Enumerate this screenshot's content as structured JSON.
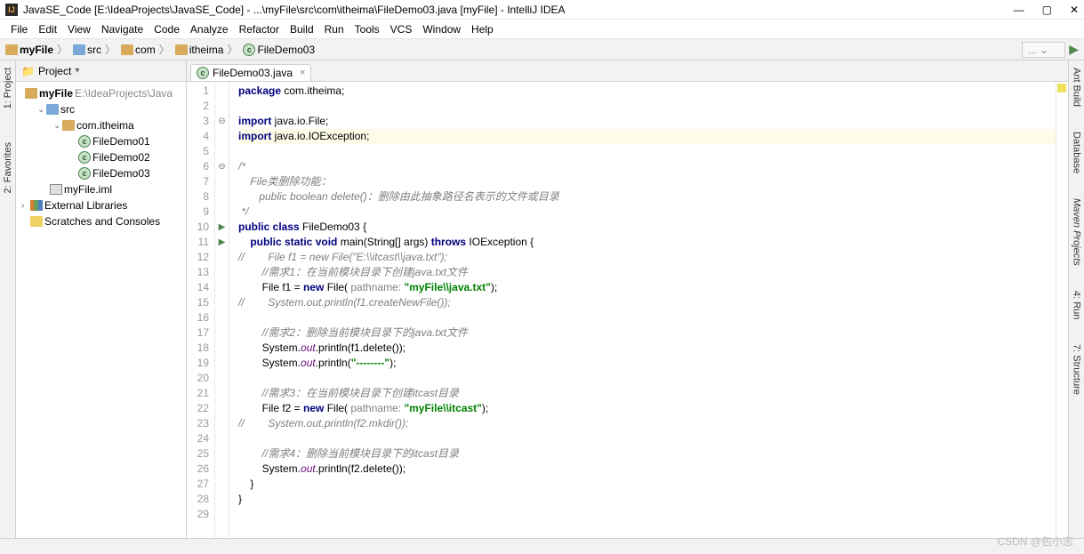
{
  "title": "JavaSE_Code [E:\\IdeaProjects\\JavaSE_Code] - ...\\myFile\\src\\com\\itheima\\FileDemo03.java [myFile] - IntelliJ IDEA",
  "menu": [
    "File",
    "Edit",
    "View",
    "Navigate",
    "Code",
    "Analyze",
    "Refactor",
    "Build",
    "Run",
    "Tools",
    "VCS",
    "Window",
    "Help"
  ],
  "breadcrumb": [
    {
      "icon": "folder",
      "label": "myFile"
    },
    {
      "icon": "folder-blue",
      "label": "src"
    },
    {
      "icon": "folder",
      "label": "com"
    },
    {
      "icon": "folder",
      "label": "itheima"
    },
    {
      "icon": "class",
      "label": "FileDemo03"
    }
  ],
  "run_config": "...",
  "sidebar": {
    "title": "Project",
    "root": {
      "label": "myFile",
      "path": "E:\\IdeaProjects\\Java"
    },
    "src": "src",
    "pkg": "com.itheima",
    "files": [
      "FileDemo01",
      "FileDemo02",
      "FileDemo03"
    ],
    "iml": "myFile.iml",
    "ext": "External Libraries",
    "scratch": "Scratches and Consoles"
  },
  "left_tabs": [
    "2: Favorites",
    "1: Project"
  ],
  "right_tabs": [
    "Ant Build",
    "Database",
    "Maven Projects",
    "4: Run",
    "7: Structure"
  ],
  "tab": "FileDemo03.java",
  "code_lines": [
    {
      "n": 1,
      "t": "<kw>package</kw> com.itheima;"
    },
    {
      "n": 2,
      "t": ""
    },
    {
      "n": 3,
      "g": "⊖",
      "t": "<kw>import</kw> java.io.File;"
    },
    {
      "n": 4,
      "hl": true,
      "t": "<kw>import</kw> java.io.IOException;"
    },
    {
      "n": 5,
      "t": ""
    },
    {
      "n": 6,
      "g": "⊖",
      "t": "<cm>/*</cm>"
    },
    {
      "n": 7,
      "t": "<cm>    File类删除功能：</cm>"
    },
    {
      "n": 8,
      "t": "<cm>       public boolean delete()：删除由此抽象路径名表示的文件或目录</cm>"
    },
    {
      "n": 9,
      "t": "<cm> */</cm>"
    },
    {
      "n": 10,
      "g": "▶",
      "t": "<kw>public class</kw> FileDemo03 {"
    },
    {
      "n": 11,
      "g": "▶",
      "t": "    <kw>public static void</kw> main(String[] args) <kw>throws</kw> <cls>IOException</cls> {"
    },
    {
      "n": 12,
      "t": "<cm>//        File f1 = new File(\"E:\\\\itcast\\\\java.txt\");</cm>"
    },
    {
      "n": 13,
      "t": "        <cm>//需求1：在当前模块目录下创建java.txt文件</cm>"
    },
    {
      "n": 14,
      "t": "        File f1 = <kw>new</kw> File( <param>pathname:</param> <str>\"myFile\\\\java.txt\"</str>);"
    },
    {
      "n": 15,
      "t": "<cm>//        System.out.println(f1.createNewFile());</cm>"
    },
    {
      "n": 16,
      "t": ""
    },
    {
      "n": 17,
      "t": "        <cm>//需求2：删除当前模块目录下的java.txt文件</cm>"
    },
    {
      "n": 18,
      "t": "        System.<stat>out</stat>.println(f1.delete());"
    },
    {
      "n": 19,
      "t": "        System.<stat>out</stat>.println(<str>\"--------\"</str>);"
    },
    {
      "n": 20,
      "t": ""
    },
    {
      "n": 21,
      "t": "        <cm>//需求3：在当前模块目录下创建itcast目录</cm>"
    },
    {
      "n": 22,
      "t": "        File f2 = <kw>new</kw> File( <param>pathname:</param> <str>\"myFile\\\\itcast\"</str>);"
    },
    {
      "n": 23,
      "t": "<cm>//        System.out.println(f2.mkdir());</cm>"
    },
    {
      "n": 24,
      "t": ""
    },
    {
      "n": 25,
      "t": "        <cm>//需求4：删除当前模块目录下的itcast目录</cm>"
    },
    {
      "n": 26,
      "t": "        System.<stat>out</stat>.println(f2.delete());"
    },
    {
      "n": 27,
      "t": "    }"
    },
    {
      "n": 28,
      "t": "}"
    },
    {
      "n": 29,
      "t": ""
    }
  ],
  "watermark": "CSDN @包小志"
}
